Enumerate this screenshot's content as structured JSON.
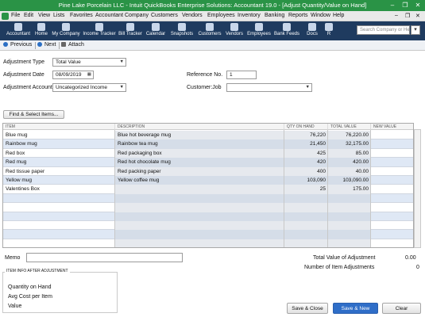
{
  "window": {
    "title": "Pine Lake Porcelain LLC  -  Intuit QuickBooks Enterprise Solutions: Accountant 19.0 - [Adjust Quantity/Value on Hand]",
    "minimize": "–",
    "restore": "❐",
    "close": "✕"
  },
  "menu": [
    "File",
    "Edit",
    "View",
    "Lists",
    "Favorites",
    "Accountant",
    "Company",
    "Customers",
    "Vendors",
    "Employees",
    "Inventory",
    "Banking",
    "Reports",
    "Window",
    "Help"
  ],
  "menu_right": {
    "minimize": "–",
    "restore": "❐",
    "close": "✕"
  },
  "navbar": {
    "items": [
      "Accountant",
      "Home",
      "My Company",
      "Income Tracker",
      "Bill Tracker",
      "Calendar",
      "Snapshots",
      "Customers",
      "Vendors",
      "Employees",
      "Bank Feeds",
      "Docs",
      "R"
    ],
    "search_placeholder": "Search Company or Help",
    "search_button": "▾"
  },
  "subbar": {
    "previous": "Previous",
    "next": "Next",
    "attach": "Attach"
  },
  "form": {
    "adjustment_type_label": "Adjustment Type",
    "adjustment_type_value": "Total Value",
    "adjustment_date_label": "Adjustment Date",
    "adjustment_date_value": "08/09/2019",
    "adjustment_account_label": "Adjustment Account",
    "adjustment_account_value": "Uncategorized Income",
    "reference_label": "Reference No.",
    "reference_value": "1",
    "customer_job_label": "Customer:Job",
    "customer_job_value": "",
    "find_button": "Find & Select Items..."
  },
  "grid": {
    "columns": [
      "ITEM",
      "DESCRIPTION",
      "QTY ON HAND",
      "TOTAL VALUE",
      "NEW VALUE"
    ],
    "rows": [
      [
        "Blue mug",
        "Blue hot beverage mug",
        "76,220",
        "76,220.00",
        ""
      ],
      [
        "Rainbow mug",
        "Rainbow tea mug",
        "21,450",
        "32,175.00",
        ""
      ],
      [
        "Red box",
        "Red packaging box",
        "425",
        "85.00",
        ""
      ],
      [
        "Red mug",
        "Red hot chocolate mug",
        "420",
        "420.00",
        ""
      ],
      [
        "Red tissue paper",
        "Red packing paper",
        "400",
        "40.00",
        ""
      ],
      [
        "Yellow mug",
        "Yellow coffee mug",
        "103,090",
        "103,090.00",
        ""
      ],
      [
        "Valentines Box",
        "",
        "25",
        "175.00",
        ""
      ],
      [
        "",
        "",
        "",
        "",
        ""
      ],
      [
        "",
        "",
        "",
        "",
        ""
      ],
      [
        "",
        "",
        "",
        "",
        ""
      ],
      [
        "",
        "",
        "",
        "",
        ""
      ],
      [
        "",
        "",
        "",
        "",
        ""
      ],
      [
        "",
        "",
        "",
        "",
        ""
      ]
    ]
  },
  "footer": {
    "memo_label": "Memo",
    "memo_value": "",
    "total_value_label": "Total Value of Adjustment",
    "total_value": "0.00",
    "num_items_label": "Number of Item Adjustments",
    "num_items": "0",
    "info_title": "ITEM INFO AFTER ADJUSTMENT",
    "info_rows": [
      "Quantity on Hand",
      "Avg Cost per Item",
      "Value"
    ],
    "save_close": "Save & Close",
    "save_new": "Save & New",
    "clear": "Clear"
  },
  "colors": {
    "titlebar": "#2a9346",
    "navbar": "#1f3b5f",
    "row_alt": "#dfe8f5",
    "primary_button": "#2f6ec8"
  }
}
